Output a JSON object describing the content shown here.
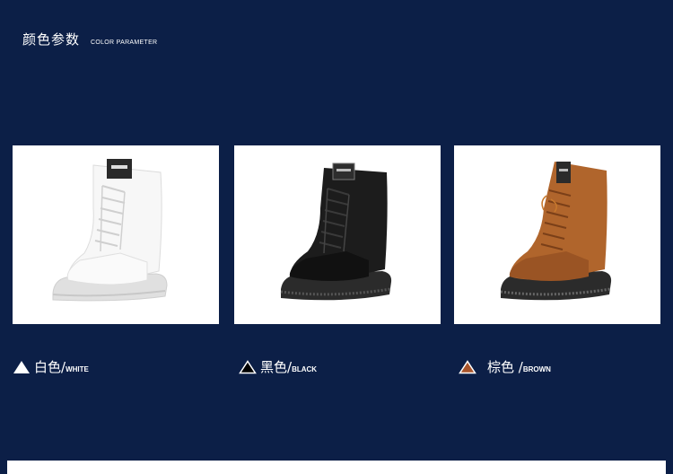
{
  "header": {
    "title_cn": "颜色参数",
    "title_en": "COLOR PARAMETER"
  },
  "colors": {
    "background": "#0c1f47",
    "white_boot": "#f4f4f4",
    "black_boot": "#1c1c1c",
    "brown_boot": "#b0652c"
  },
  "variants": [
    {
      "name_cn": "白色",
      "slash": "/",
      "name_en": "WHITE",
      "icon": "triangle-filled-white-icon"
    },
    {
      "name_cn": "黑色",
      "slash": "/",
      "name_en": "BLACK",
      "icon": "triangle-black-outlined-icon"
    },
    {
      "name_cn": "棕色 ",
      "slash": "/",
      "name_en": "BROWN",
      "icon": "triangle-brown-outlined-icon"
    }
  ]
}
